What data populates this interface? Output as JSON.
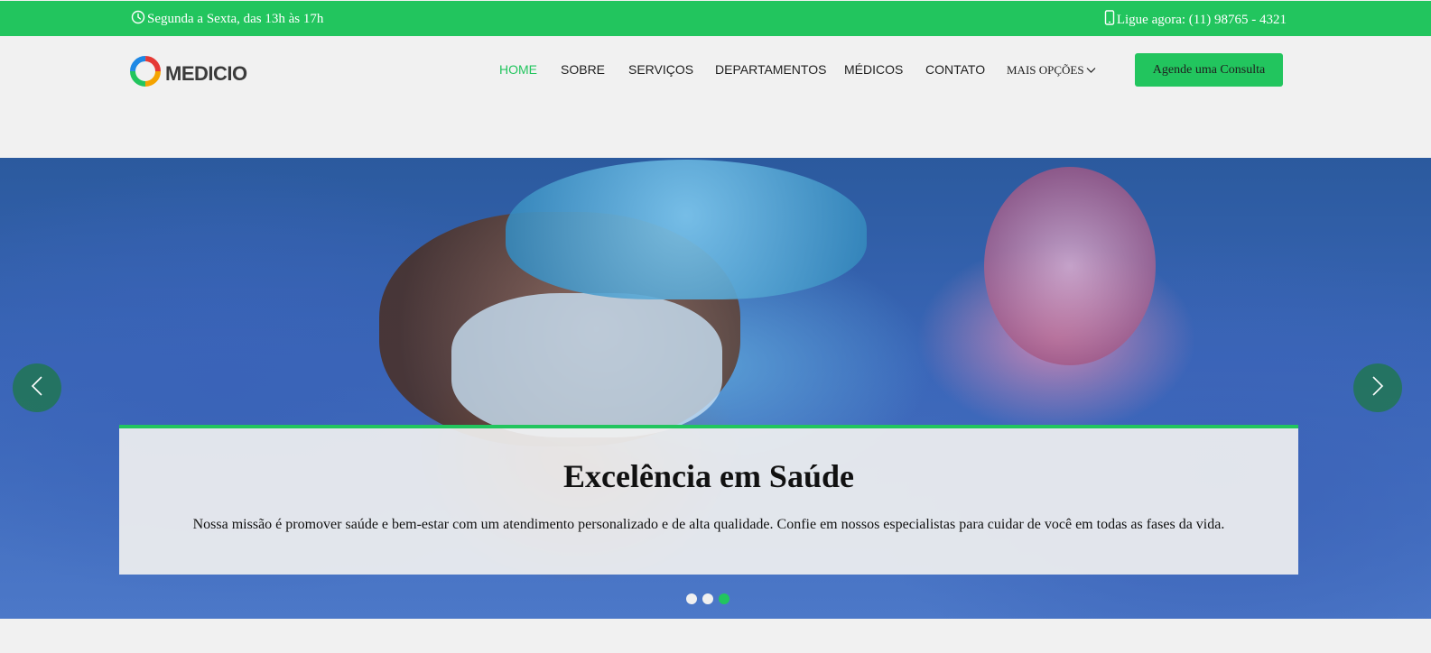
{
  "topbar": {
    "hours": "Segunda a Sexta, das 13h às 17h",
    "hours_icon": "clock-icon",
    "phone": "Ligue agora: (11) 98765 - 4321",
    "phone_icon": "phone-icon"
  },
  "brand": {
    "name": "MEDICIO",
    "accent": "#22c55e"
  },
  "nav": {
    "home": "HOME",
    "about": "SOBRE",
    "services": "SERVIÇOS",
    "departments": "DEPARTAMENTOS",
    "doctors": "MÉDICOS",
    "contact": "CONTATO",
    "more": "MAIS OPÇÕES",
    "active": "HOME"
  },
  "cta": {
    "label": "Agende uma Consulta"
  },
  "hero": {
    "title": "Excelência em Saúde",
    "text": "Nossa missão é promover saúde e bem-estar com um atendimento personalizado e de alta qualidade. Confie em nossos especialistas para cuidar de você em todas as fases da vida.",
    "slide_count": 3,
    "active_slide": 3
  }
}
